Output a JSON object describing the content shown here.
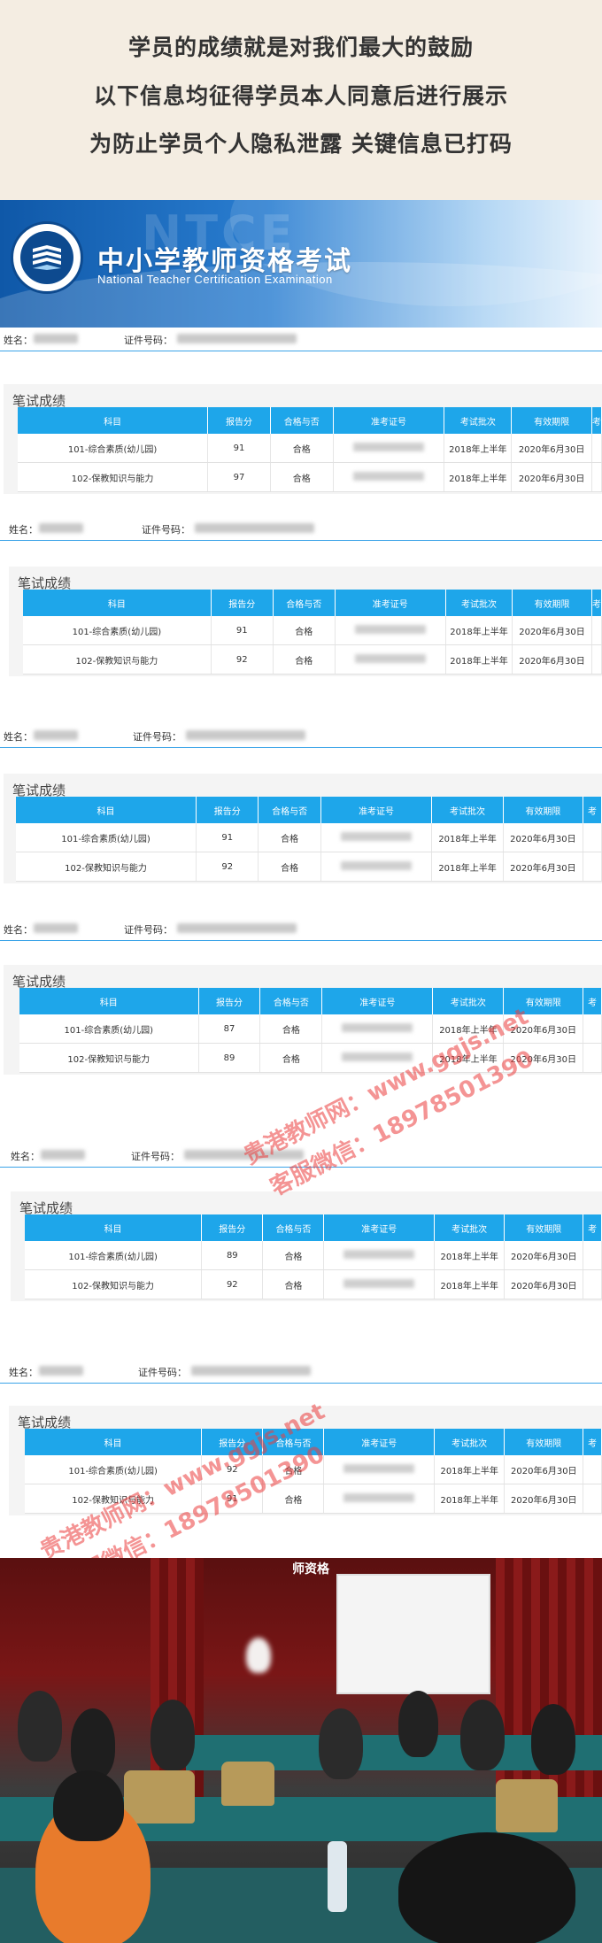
{
  "intro": {
    "lines": [
      "学员的成绩就是对我们最大的鼓励",
      "以下信息均征得学员本人同意后进行展示",
      "为防止学员个人隐私泄露 关键信息已打码"
    ]
  },
  "banner": {
    "title": "中小学教师资格考试",
    "subtitle": "National Teacher Certification Examination",
    "bg_text": "NTCE",
    "logo_icon": "ntce-logo-icon"
  },
  "labels": {
    "name": "姓名：",
    "id": "证件号码：",
    "card_title": "笔试成绩"
  },
  "table_headers": [
    "科目",
    "报告分",
    "合格与否",
    "准考证号",
    "考试批次",
    "有效期限",
    "考"
  ],
  "records": [
    {
      "rows": [
        {
          "subject": "101-综合素质(幼儿园)",
          "score": "91",
          "pass": "合格",
          "batch": "2018年上半年",
          "valid": "2020年6月30日"
        },
        {
          "subject": "102-保教知识与能力",
          "score": "97",
          "pass": "合格",
          "batch": "2018年上半年",
          "valid": "2020年6月30日"
        }
      ]
    },
    {
      "rows": [
        {
          "subject": "101-综合素质(幼儿园)",
          "score": "91",
          "pass": "合格",
          "batch": "2018年上半年",
          "valid": "2020年6月30日"
        },
        {
          "subject": "102-保教知识与能力",
          "score": "92",
          "pass": "合格",
          "batch": "2018年上半年",
          "valid": "2020年6月30日"
        }
      ]
    },
    {
      "rows": [
        {
          "subject": "101-综合素质(幼儿园)",
          "score": "91",
          "pass": "合格",
          "batch": "2018年上半年",
          "valid": "2020年6月30日"
        },
        {
          "subject": "102-保教知识与能力",
          "score": "92",
          "pass": "合格",
          "batch": "2018年上半年",
          "valid": "2020年6月30日"
        }
      ]
    },
    {
      "rows": [
        {
          "subject": "101-综合素质(幼儿园)",
          "score": "87",
          "pass": "合格",
          "batch": "2018年上半年",
          "valid": "2020年6月30日"
        },
        {
          "subject": "102-保教知识与能力",
          "score": "89",
          "pass": "合格",
          "batch": "2018年上半年",
          "valid": "2020年6月30日"
        }
      ]
    },
    {
      "rows": [
        {
          "subject": "101-综合素质(幼儿园)",
          "score": "89",
          "pass": "合格",
          "batch": "2018年上半年",
          "valid": "2020年6月30日"
        },
        {
          "subject": "102-保教知识与能力",
          "score": "92",
          "pass": "合格",
          "batch": "2018年上半年",
          "valid": "2020年6月30日"
        }
      ]
    },
    {
      "rows": [
        {
          "subject": "101-综合素质(幼儿园)",
          "score": "92",
          "pass": "合格",
          "batch": "2018年上半年",
          "valid": "2020年6月30日"
        },
        {
          "subject": "102-保教知识与能力",
          "score": "91",
          "pass": "合格",
          "batch": "2018年上半年",
          "valid": "2020年6月30日"
        }
      ]
    }
  ],
  "watermarks": {
    "line1": "贵港教师网：www.ggjs.net",
    "line2": "客服微信：18978501390"
  },
  "photo": {
    "banner_text": "师资格"
  },
  "colors": {
    "table_header": "#1ea6ea",
    "accent_line": "#3aa3e8",
    "watermark": "#eb3c3c"
  }
}
